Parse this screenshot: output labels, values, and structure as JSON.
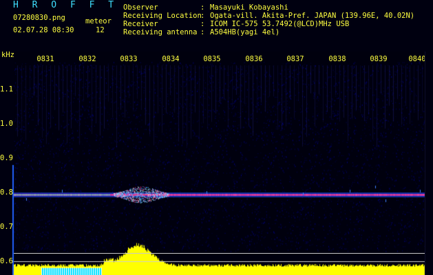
{
  "header": {
    "title": "H R O F F T",
    "file_name": "07280830.png",
    "meteor_label": "meteor",
    "datetime": "02.07.28 08:30",
    "meteor_count": "12"
  },
  "meta": [
    {
      "label": "Observer",
      "sep": ":",
      "value": "Masayuki Kobayashi"
    },
    {
      "label": "Receiving Location",
      "sep": ":",
      "value": "Ogata-vill. Akita-Pref. JAPAN (139.96E, 40.02N)"
    },
    {
      "label": "Receiver",
      "sep": ":",
      "value": "ICOM IC-575 53.7492(@LCD)MHz USB"
    },
    {
      "label": "Receiving antenna",
      "sep": ":",
      "value": "A504HB(yagi 4el)"
    }
  ],
  "axis": {
    "y_unit": "kHz",
    "y_ticks": [
      "1.1",
      "1.0",
      "0.9",
      "0.8",
      "0.7",
      "0.6"
    ],
    "x_ticks": [
      "0831",
      "0832",
      "0833",
      "0834",
      "0835",
      "0836",
      "0837",
      "0838",
      "0839",
      "0840"
    ]
  },
  "colors": {
    "header_text": "#40ff40",
    "axis_text": "#ffff40",
    "trace": "#ff4040",
    "echo": "#40e0ff",
    "power_bar": "#ffff00",
    "power_low": "#00e0ff"
  }
}
